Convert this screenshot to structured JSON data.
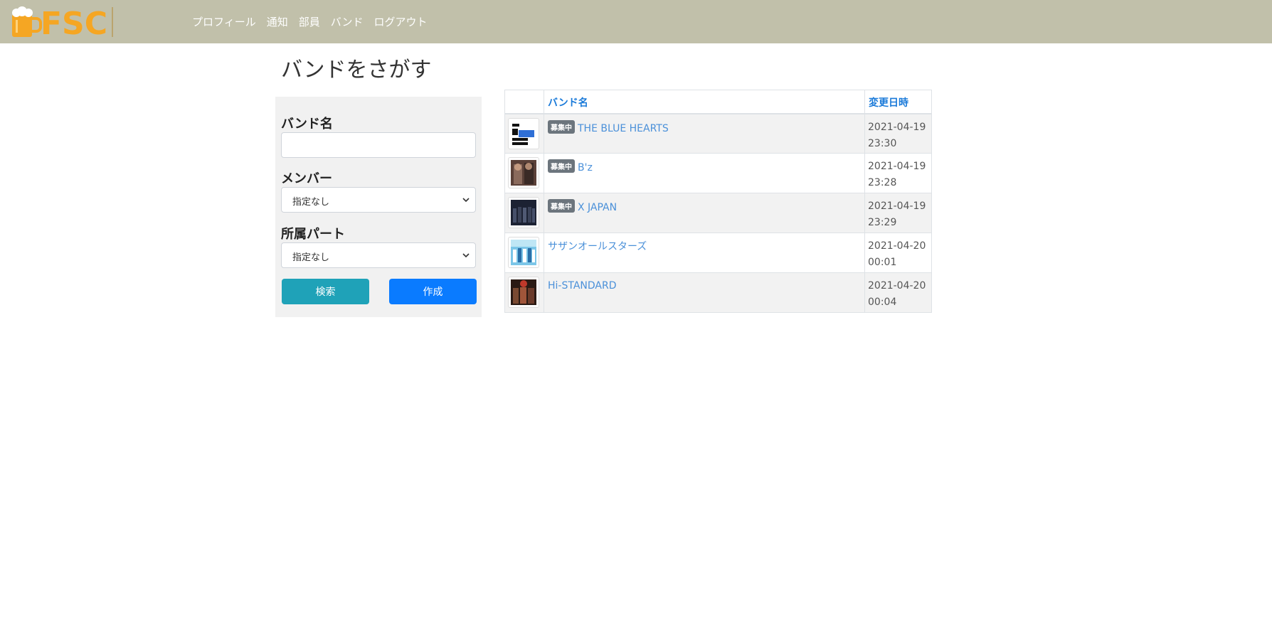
{
  "header": {
    "logo_text": "FSC",
    "nav": [
      "プロフィール",
      "通知",
      "部員",
      "バンド",
      "ログアウト"
    ]
  },
  "page": {
    "title": "バンドをさがす"
  },
  "search": {
    "band_name_label": "バンド名",
    "band_name_value": "",
    "member_label": "メンバー",
    "member_selected": "指定なし",
    "part_label": "所属パート",
    "part_selected": "指定なし",
    "search_button": "検索",
    "create_button": "作成"
  },
  "table": {
    "headers": {
      "name": "バンド名",
      "updated": "変更日時"
    },
    "rows": [
      {
        "badge": "募集中",
        "name": "THE BLUE HEARTS",
        "date": "2021-04-19",
        "time": "23:30"
      },
      {
        "badge": "募集中",
        "name": "B'z",
        "date": "2021-04-19",
        "time": "23:28"
      },
      {
        "badge": "募集中",
        "name": "X JAPAN",
        "date": "2021-04-19",
        "time": "23:29"
      },
      {
        "badge": "",
        "name": "サザンオールスターズ",
        "date": "2021-04-20",
        "time": "00:01"
      },
      {
        "badge": "",
        "name": "Hi-STANDARD",
        "date": "2021-04-20",
        "time": "00:04"
      }
    ]
  },
  "colors": {
    "navbar": "#c1c0aa",
    "logo": "#f5a623",
    "search_button": "#1fa2b8",
    "create_button": "#0a7bff",
    "link": "#4a90d9",
    "badge": "#6c757d"
  }
}
